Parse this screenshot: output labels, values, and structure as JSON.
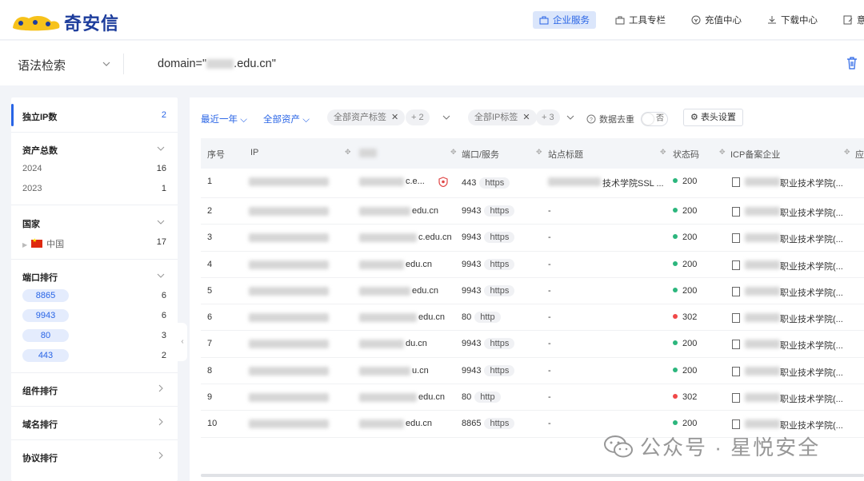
{
  "app": {
    "logo_text": "奇安信",
    "brand_color": "#1d3d9c",
    "accent": "#2864e6"
  },
  "nav": [
    {
      "label": "企业服务",
      "icon": "briefcase-icon",
      "active": true
    },
    {
      "label": "工具专栏",
      "icon": "toolbox-icon",
      "active": false
    },
    {
      "label": "充值中心",
      "icon": "coin-icon",
      "active": false
    },
    {
      "label": "下载中心",
      "icon": "download-icon",
      "active": false
    },
    {
      "label": "意见",
      "icon": "feedback-icon",
      "active": false
    }
  ],
  "search": {
    "syntax_label": "语法检索",
    "query_prefix": "domain=\"",
    "query_suffix": ".edu.cn\""
  },
  "sidebar": {
    "unique_ip": {
      "label": "独立IP数",
      "count": "2"
    },
    "assets": {
      "label": "资产总数",
      "items": [
        {
          "label": "2024",
          "value": "16"
        },
        {
          "label": "2023",
          "value": "1"
        }
      ]
    },
    "country": {
      "label": "国家",
      "items": [
        {
          "label": "中国",
          "value": "17"
        }
      ]
    },
    "ports": {
      "label": "端口排行",
      "items": [
        {
          "label": "8865",
          "value": "6"
        },
        {
          "label": "9943",
          "value": "6"
        },
        {
          "label": "80",
          "value": "3"
        },
        {
          "label": "443",
          "value": "2"
        }
      ]
    },
    "component_rank": "组件排行",
    "domain_rank": "域名排行",
    "protocol_rank": "协议排行"
  },
  "filters": {
    "time": "最近一年",
    "asset_scope": "全部资产",
    "asset_tag": "全部资产标签",
    "asset_tag_more": "+ 2",
    "ip_tag": "全部IP标签",
    "ip_tag_more": "+ 3",
    "dedup_label": "数据去重",
    "dedup_value": "否",
    "header_settings": "表头设置"
  },
  "table": {
    "columns": [
      "序号",
      "IP",
      "",
      "端口/服务",
      "站点标题",
      "状态码",
      "ICP备案企业",
      "应"
    ],
    "rows": [
      {
        "no": "1",
        "domain": "c.e...",
        "port": "443",
        "svc": "https",
        "title": "技术学院SSL ...",
        "status": "200",
        "icp": "职业技术学院(..."
      },
      {
        "no": "2",
        "domain": "edu.cn",
        "port": "9943",
        "svc": "https",
        "title": "-",
        "status": "200",
        "icp": "职业技术学院(..."
      },
      {
        "no": "3",
        "domain": "c.edu.cn",
        "port": "9943",
        "svc": "https",
        "title": "-",
        "status": "200",
        "icp": "职业技术学院(..."
      },
      {
        "no": "4",
        "domain": "edu.cn",
        "port": "9943",
        "svc": "https",
        "title": "-",
        "status": "200",
        "icp": "职业技术学院(..."
      },
      {
        "no": "5",
        "domain": "edu.cn",
        "port": "9943",
        "svc": "https",
        "title": "-",
        "status": "200",
        "icp": "职业技术学院(..."
      },
      {
        "no": "6",
        "domain": "edu.cn",
        "port": "80",
        "svc": "http",
        "title": "-",
        "status": "302",
        "icp": "职业技术学院(..."
      },
      {
        "no": "7",
        "domain": "du.cn",
        "port": "9943",
        "svc": "https",
        "title": "-",
        "status": "200",
        "icp": "职业技术学院(..."
      },
      {
        "no": "8",
        "domain": "u.cn",
        "port": "9943",
        "svc": "https",
        "title": "-",
        "status": "200",
        "icp": "职业技术学院(..."
      },
      {
        "no": "9",
        "domain": "edu.cn",
        "port": "80",
        "svc": "http",
        "title": "-",
        "status": "302",
        "icp": "职业技术学院(..."
      },
      {
        "no": "10",
        "domain": "edu.cn",
        "port": "8865",
        "svc": "https",
        "title": "-",
        "status": "200",
        "icp": "职业技术学院(..."
      }
    ],
    "status_colors": {
      "200": "#2cb67d",
      "302": "#f04848"
    }
  },
  "watermark": "公众号 · 星悦安全"
}
